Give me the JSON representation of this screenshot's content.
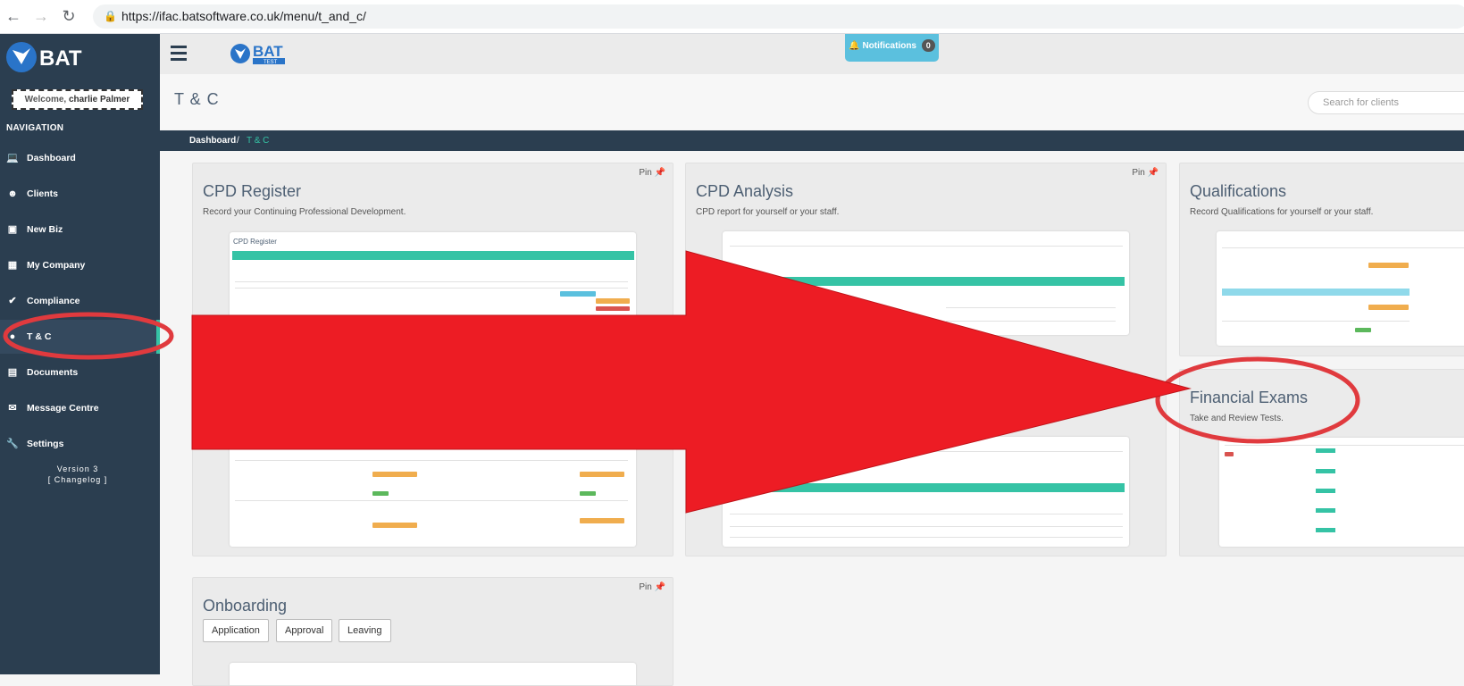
{
  "browser": {
    "url": "https://ifac.batsoftware.co.uk/menu/t_and_c/"
  },
  "sidebar": {
    "logo_text": "BAT",
    "welcome_prefix": "Welcome,",
    "welcome_name": "charlie Palmer",
    "nav_heading": "NAVIGATION",
    "items": [
      {
        "label": "Dashboard",
        "icon": "laptop-icon"
      },
      {
        "label": "Clients",
        "icon": "users-icon"
      },
      {
        "label": "New Biz",
        "icon": "money-icon"
      },
      {
        "label": "My Company",
        "icon": "building-icon"
      },
      {
        "label": "Compliance",
        "icon": "check-icon"
      },
      {
        "label": "T & C",
        "icon": "circle-icon"
      },
      {
        "label": "Documents",
        "icon": "book-icon"
      },
      {
        "label": "Message Centre",
        "icon": "envelope-icon"
      },
      {
        "label": "Settings",
        "icon": "wrench-icon"
      }
    ],
    "version": "Version 3",
    "changelog": "[ Changelog ]"
  },
  "topbar": {
    "logo_text": "BAT",
    "logo_sub": "TEST",
    "notifications_label": "Notifications",
    "notifications_count": "0"
  },
  "header": {
    "title": "T & C",
    "search_placeholder": "Search for clients"
  },
  "breadcrumb": {
    "root": "Dashboard",
    "separator": "/",
    "current": "T & C"
  },
  "cards": {
    "pin_label": "Pin",
    "cpd_register": {
      "title": "CPD Register",
      "desc": "Record your Continuing Professional Development.",
      "preview_title": "CPD Register"
    },
    "cpd_analysis": {
      "title": "CPD Analysis",
      "desc": "CPD report for yourself or your staff."
    },
    "qualifications": {
      "title": "Qualifications",
      "desc": "Record Qualifications for yourself or your staff."
    },
    "financial_exams": {
      "title": "Financial Exams",
      "desc": "Take and Review Tests."
    },
    "onboarding": {
      "title": "Onboarding",
      "buttons": [
        "Application",
        "Approval",
        "Leaving"
      ]
    }
  },
  "colors": {
    "sidebar": "#2b3e50",
    "accent": "#35c3a5",
    "annotation_red": "#ed1c24"
  }
}
